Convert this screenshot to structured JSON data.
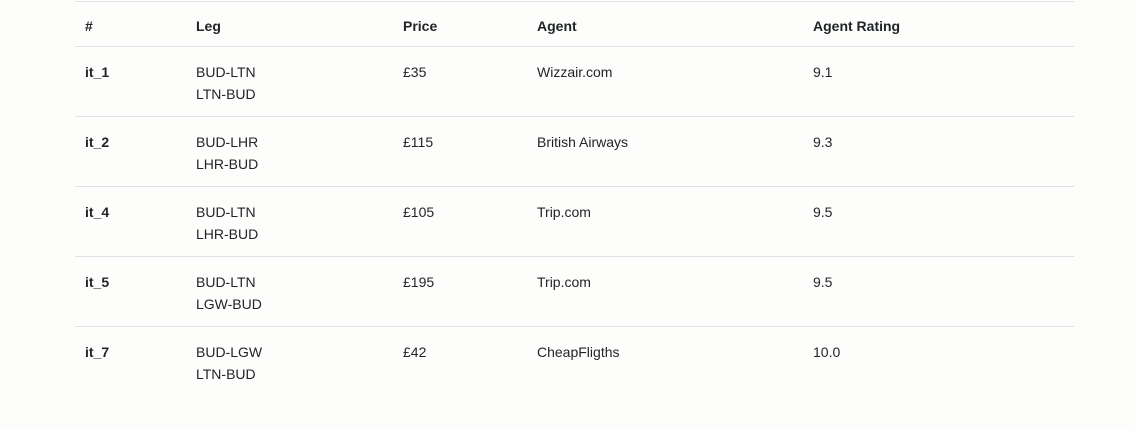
{
  "table": {
    "headers": [
      "#",
      "Leg",
      "Price",
      "Agent",
      "Agent Rating"
    ],
    "rows": [
      {
        "id": "it_1",
        "legs": [
          "BUD-LTN",
          "LTN-BUD"
        ],
        "price": "£35",
        "agent": "Wizzair.com",
        "rating": "9.1"
      },
      {
        "id": "it_2",
        "legs": [
          "BUD-LHR",
          "LHR-BUD"
        ],
        "price": "£115",
        "agent": "British Airways",
        "rating": "9.3"
      },
      {
        "id": "it_4",
        "legs": [
          "BUD-LTN",
          "LHR-BUD"
        ],
        "price": "£105",
        "agent": "Trip.com",
        "rating": "9.5"
      },
      {
        "id": "it_5",
        "legs": [
          "BUD-LTN",
          "LGW-BUD"
        ],
        "price": "£195",
        "agent": "Trip.com",
        "rating": "9.5"
      },
      {
        "id": "it_7",
        "legs": [
          "BUD-LGW",
          "LTN-BUD"
        ],
        "price": "£42",
        "agent": "CheapFligths",
        "rating": "10.0"
      }
    ]
  }
}
